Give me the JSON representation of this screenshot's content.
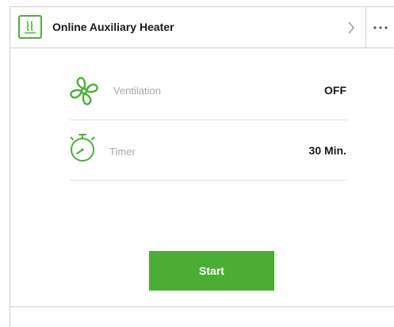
{
  "header": {
    "icon": "heater-icon",
    "title": "Online Auxiliary Heater",
    "chevron_icon": "chevron-right-icon",
    "more_icon": "more-dots-icon"
  },
  "settings": [
    {
      "id": "ventilation",
      "icon": "fan-icon",
      "label": "Ventilation",
      "value": "OFF"
    },
    {
      "id": "timer",
      "icon": "stopwatch-icon",
      "label": "Timer",
      "value": "30 Min."
    }
  ],
  "actions": {
    "start_label": "Start"
  },
  "colors": {
    "accent": "#4cad35",
    "border": "#cfcfcf",
    "muted_text": "#a8a8a8"
  }
}
